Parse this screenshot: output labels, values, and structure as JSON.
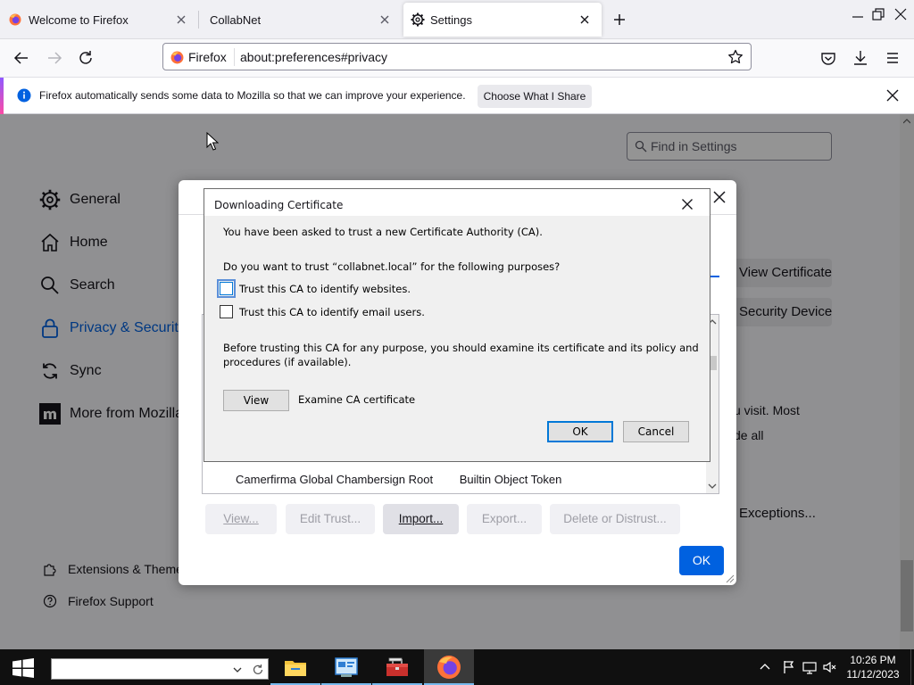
{
  "tabs": [
    {
      "title": "Welcome to Firefox",
      "icon": "firefox-icon"
    },
    {
      "title": "CollabNet",
      "icon": ""
    },
    {
      "title": "Settings",
      "icon": "gear-icon",
      "active": true
    }
  ],
  "navbar": {
    "identity_label": "Firefox",
    "url": "about:preferences#privacy"
  },
  "notification": {
    "message": "Firefox automatically sends some data to Mozilla so that we can improve your experience.",
    "button_label": "Choose What I Share"
  },
  "settings_page": {
    "find_placeholder": "Find in Settings",
    "categories": [
      {
        "label": "General",
        "icon": "gear-icon"
      },
      {
        "label": "Home",
        "icon": "home-icon"
      },
      {
        "label": "Search",
        "icon": "search-icon"
      },
      {
        "label": "Privacy & Security",
        "icon": "lock-icon",
        "selected": true
      },
      {
        "label": "Sync",
        "icon": "sync-icon"
      },
      {
        "label": "More from Mozilla",
        "icon": "mozilla-icon"
      }
    ],
    "footer_links": [
      {
        "label": "Extensions & Themes",
        "icon": "puzzle-icon"
      },
      {
        "label": "Firefox Support",
        "icon": "help-icon"
      }
    ],
    "view_certificates_label": "View Certificates...",
    "security_devices_label": "Security Devices...",
    "body_text_line1": "u visit. Most",
    "body_text_line2": "de all",
    "exceptions_label": "Exceptions..."
  },
  "certificate_manager": {
    "visible_row": {
      "name": "Camerfirma Global Chambersign Root",
      "token": "Builtin Object Token"
    },
    "buttons": {
      "view": "View...",
      "edit_trust": "Edit Trust...",
      "import": "Import...",
      "export": "Export...",
      "delete": "Delete or Distrust..."
    },
    "ok_label": "OK"
  },
  "download_dialog": {
    "title": "Downloading Certificate",
    "intro": "You have been asked to trust a new Certificate Authority (CA).",
    "question": "Do you want to trust “collabnet.local” for the following purposes?",
    "options": [
      {
        "label": "Trust this CA to identify websites.",
        "checked": false,
        "focused": true
      },
      {
        "label": "Trust this CA to identify email users.",
        "checked": false,
        "focused": false
      }
    ],
    "advice_line1": "Before trusting this CA for any purpose, you should examine its certificate and its policy and",
    "advice_line2": "procedures (if available).",
    "view_button": "View",
    "view_description": "Examine CA certificate",
    "ok_button": "OK",
    "cancel_button": "Cancel"
  },
  "taskbar": {
    "search_value": "",
    "apps": [
      {
        "name": "file-explorer",
        "icon": "folder-icon"
      },
      {
        "name": "control-panel",
        "icon": "control-panel-icon"
      },
      {
        "name": "toolbox",
        "icon": "toolbox-icon"
      },
      {
        "name": "firefox",
        "icon": "firefox-icon",
        "active": true
      }
    ],
    "time": "10:26 PM",
    "date": "11/12/2023"
  },
  "colors": {
    "accent_blue": "#0061e0",
    "overlay": "rgba(0,0,0,0.42)",
    "taskbar": "#101010"
  }
}
